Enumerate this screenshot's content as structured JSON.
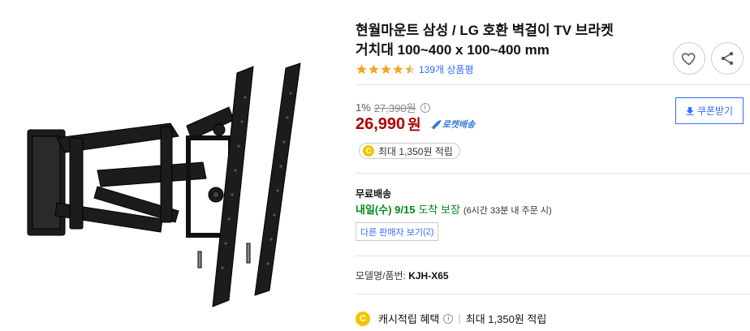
{
  "product": {
    "title_line1": "현월마운트 삼성 / LG 호환 벽걸이 TV 브라켓",
    "title_line2": "거치대 100~400 x 100~400 mm",
    "rating": 4.5,
    "review_count": "139개 상품평",
    "discount_rate": "1%",
    "original_price": "27,390원",
    "sale_price": "26,990",
    "currency_unit": "원",
    "rocket_label": "로켓배송",
    "coupon_label": "쿠폰받기",
    "reward_text": "최대 1,350원 적립",
    "shipping_label": "무료배송",
    "delivery_day": "내일(수) 9/15",
    "delivery_guarantee": "도착 보장",
    "delivery_note": "(6시간 33분 내 주문 시)",
    "other_sellers": "다른 판매자 보기",
    "other_sellers_count": "(2)",
    "model_label": "모델명/품번:",
    "model_value": "KJH-X65",
    "cash_label": "캐시적립 혜택",
    "cash_value": "최대 1,350원 적립"
  },
  "icons": {
    "wish": "heart-icon",
    "share": "share-icon",
    "coin": "C"
  },
  "colors": {
    "price": "#ae0000",
    "link": "#346aff",
    "star": "#f5a623",
    "delivery": "#00891a",
    "coin": "#f5c400"
  }
}
